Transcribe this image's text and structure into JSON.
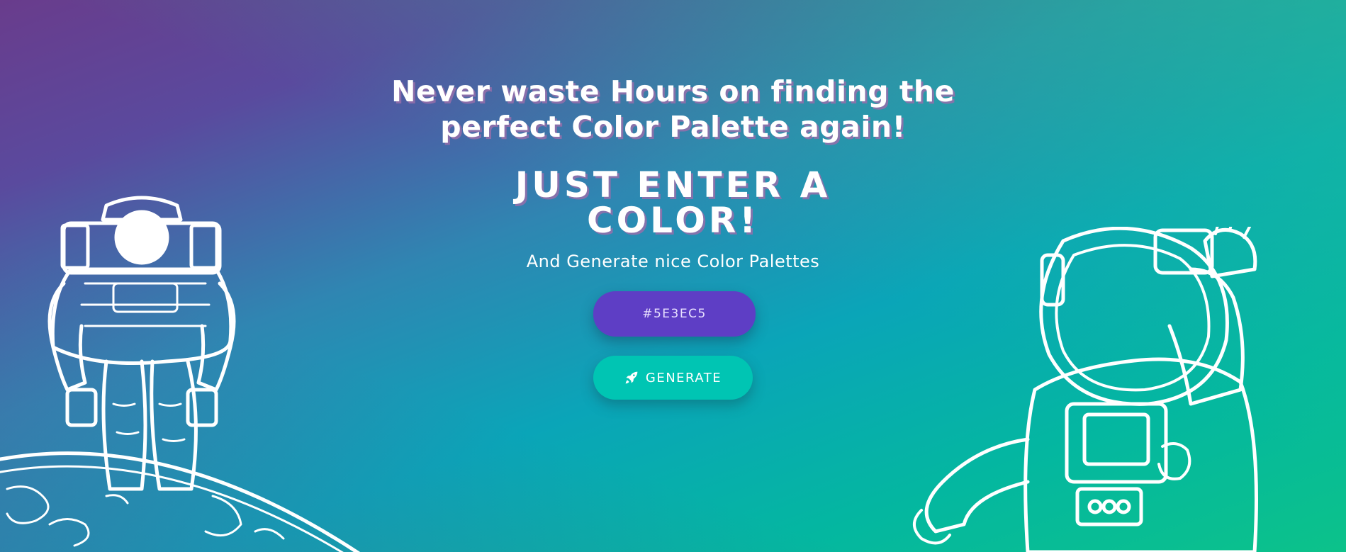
{
  "hero": {
    "headline_line1": "Never waste Hours on finding the",
    "headline_line2": "perfect Color Palette again!",
    "subhead_line1": "JUST ENTER A",
    "subhead_line2": "COLOR!",
    "tagline": "And Generate nice Color Palettes"
  },
  "color_input": {
    "value": "#5E3EC5",
    "background": "#5E3EC5"
  },
  "generate_button": {
    "label": "GENERATE",
    "icon": "rocket-icon",
    "background": "#00C5B3"
  },
  "illustrations": {
    "left": "astronaut-on-planet",
    "right": "astronaut-waving"
  },
  "colors": {
    "text": "#FFFFFF",
    "text_shadow": "#966EAA"
  }
}
